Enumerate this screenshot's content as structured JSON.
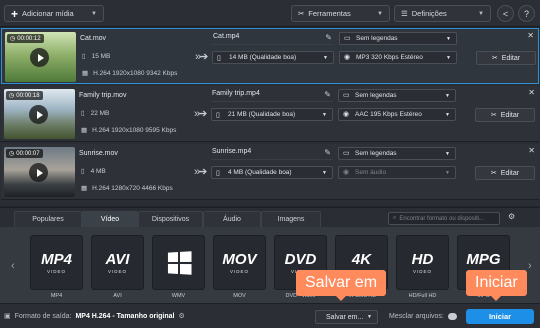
{
  "toolbar": {
    "add_media": "Adicionar mídia",
    "tools": "Ferramentas",
    "settings": "Definições",
    "share_icon": "share-icon",
    "help": "?"
  },
  "files": [
    {
      "duration": "00:00:12",
      "name": "Cat.mov",
      "size": "15 MB",
      "meta": "H.264 1920x1080 9342 Kbps",
      "output": "Cat.mp4",
      "quality": "14 MB (Qualidade boa)",
      "subtitles": "Sem legendas",
      "audio": "MP3 320 Kbps Estéreo",
      "audio_disabled": false,
      "edit": "Editar",
      "selected": true
    },
    {
      "duration": "00:00:18",
      "name": "Family trip.mov",
      "size": "22 MB",
      "meta": "H.264 1920x1080 9595 Kbps",
      "output": "Family trip.mp4",
      "quality": "21 MB (Qualidade boa)",
      "subtitles": "Sem legendas",
      "audio": "AAC 195 Kbps Estéreo",
      "audio_disabled": false,
      "edit": "Editar",
      "selected": false
    },
    {
      "duration": "00:00:07",
      "name": "Sunrise.mov",
      "size": "4 MB",
      "meta": "H.264 1280x720 4466 Kbps",
      "output": "Sunrise.mp4",
      "quality": "4 MB (Qualidade boa)",
      "subtitles": "Sem legendas",
      "audio": "Sem áudio",
      "audio_disabled": true,
      "edit": "Editar",
      "selected": false
    }
  ],
  "tabs": [
    "Populares",
    "Vídeo",
    "Dispositivos",
    "Áudio",
    "Imagens"
  ],
  "active_tab": "Vídeo",
  "search_placeholder": "Encontrar formato ou dispositi...",
  "formats": [
    {
      "big": "MP4",
      "small": "VIDEO",
      "label": "MP4"
    },
    {
      "big": "AVI",
      "small": "VIDEO",
      "label": "AVI"
    },
    {
      "big": "",
      "small": "",
      "label": "WMV",
      "icon": "windows-logo-icon"
    },
    {
      "big": "MOV",
      "small": "VIDEO",
      "label": "MOV"
    },
    {
      "big": "DVD",
      "small": "VIDEO",
      "label": "DVD - vídeo"
    },
    {
      "big": "4K",
      "small": "ULTRA HD",
      "label": "4K Ultra HD"
    },
    {
      "big": "HD",
      "small": "VIDEO",
      "label": "HD/Full HD"
    },
    {
      "big": "MPG",
      "small": "VIDEO",
      "label": "MPG"
    }
  ],
  "bottom": {
    "output_label": "Formato de saída:",
    "output_value": "MP4 H.264 - Tamanho original",
    "save_to": "Salvar em...",
    "merge": "Mesclar arquivos:",
    "start": "Iniciar"
  },
  "callouts": {
    "save": "Salvar em",
    "start": "Iniciar"
  },
  "colors": {
    "accent": "#1e8fe6",
    "callout": "#ff8a5c",
    "selection": "#2d8fd5"
  }
}
